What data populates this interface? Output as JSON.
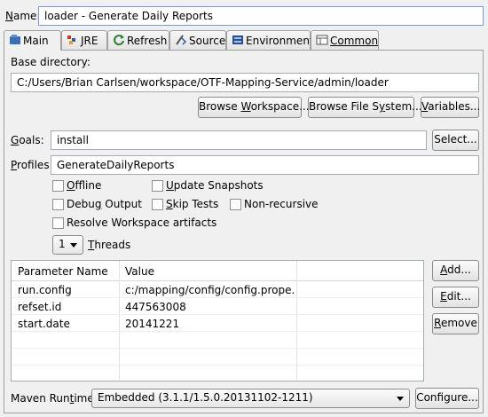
{
  "name_label": "Name:",
  "name_value": "loader - Generate Daily Reports",
  "tabs": [
    {
      "label": "Main",
      "icon": "main-icon"
    },
    {
      "label": "JRE",
      "icon": "jre-icon"
    },
    {
      "label": "Refresh",
      "icon": "refresh-icon"
    },
    {
      "label": "Source",
      "icon": "source-icon"
    },
    {
      "label": "Environment",
      "icon": "environment-icon"
    },
    {
      "label": "Common",
      "icon": "common-icon"
    }
  ],
  "base_dir_label": "Base directory:",
  "base_dir_value": "C:/Users/Brian Carlsen/workspace/OTF-Mapping-Service/admin/loader",
  "browse_workspace": "Browse Workspace...",
  "browse_fs": "Browse File System...",
  "variables": "Variables...",
  "goals_label": "Goals:",
  "goals_value": "install",
  "select_button": "Select...",
  "profiles_label": "Profiles:",
  "profiles_value": "GenerateDailyReports",
  "options": {
    "offline": "Offline",
    "update_snapshots": "Update Snapshots",
    "debug_output": "Debug Output",
    "skip_tests": "Skip Tests",
    "non_recursive": "Non-recursive",
    "resolve_workspace": "Resolve Workspace artifacts"
  },
  "threads_value": "1",
  "threads_label": "Threads",
  "table": {
    "columns": [
      "Parameter Name",
      "Value"
    ],
    "rows": [
      [
        "run.config",
        "c:/mapping/config/config.prope..."
      ],
      [
        "refset.id",
        "447563008"
      ],
      [
        "start.date",
        "20141221"
      ]
    ]
  },
  "add_button": "Add...",
  "edit_button": "Edit...",
  "remove_button": "Remove",
  "maven_runtime_label": "Maven Runtime:",
  "maven_runtime_value": "Embedded (3.1.1/1.5.0.20131102-1211)",
  "configure_button": "Configure..."
}
